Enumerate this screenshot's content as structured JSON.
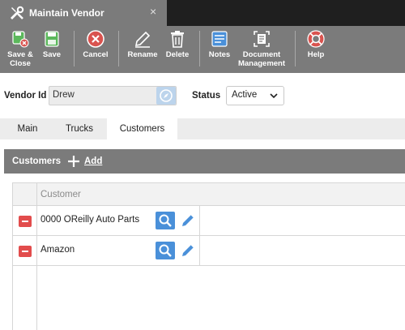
{
  "window": {
    "title": "Maintain Vendor",
    "close_glyph": "×"
  },
  "toolbar": {
    "buttons": [
      {
        "label": "Save &\nClose",
        "icon": "save-close-icon"
      },
      {
        "label": "Save",
        "icon": "save-icon"
      },
      {
        "label": "Cancel",
        "icon": "cancel-icon"
      },
      {
        "label": "Rename",
        "icon": "rename-icon"
      },
      {
        "label": "Delete",
        "icon": "trash-icon"
      },
      {
        "label": "Notes",
        "icon": "notes-icon"
      },
      {
        "label": "Document\nManagement",
        "icon": "document-scan-icon"
      },
      {
        "label": "Help",
        "icon": "lifebuoy-icon"
      }
    ]
  },
  "vendor": {
    "id_label": "Vendor Id",
    "id_value": "Drew",
    "status_label": "Status",
    "status_value": "Active"
  },
  "tabs": [
    {
      "label": "Main"
    },
    {
      "label": "Trucks"
    },
    {
      "label": "Customers"
    }
  ],
  "active_tab": "Customers",
  "customers_section": {
    "title": "Customers",
    "add_label": "Add",
    "column_header": "Customer",
    "rows": [
      {
        "name": "0000 OReilly Auto Parts"
      },
      {
        "name": "Amazon"
      }
    ]
  },
  "colors": {
    "toolbar_bg": "#7b7b7b",
    "title_bg": "#1f1f1f",
    "delete_red": "#e24c4c",
    "search_blue": "#4a90d9"
  }
}
